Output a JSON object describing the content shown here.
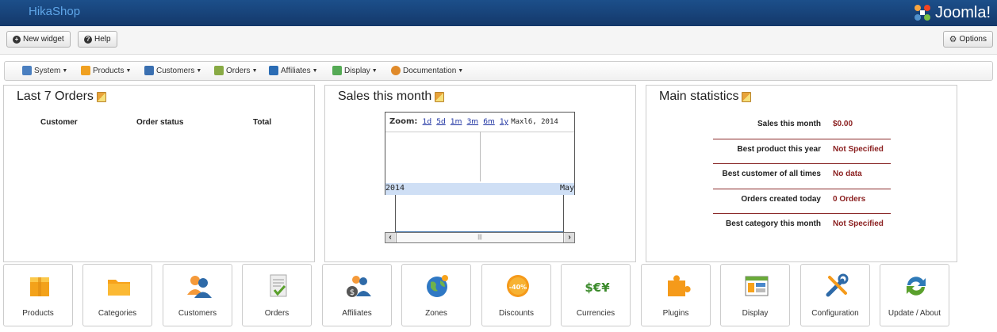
{
  "header": {
    "title": "HikaShop",
    "brand": "Joomla!"
  },
  "toolbar": {
    "new_widget": "New widget",
    "help": "Help",
    "options": "Options"
  },
  "menu": [
    {
      "label": "System",
      "icon": "tools-icon",
      "color": "#4a7fc0"
    },
    {
      "label": "Products",
      "icon": "box-icon",
      "color": "#f0a020"
    },
    {
      "label": "Customers",
      "icon": "users-icon",
      "color": "#3a6fb0"
    },
    {
      "label": "Orders",
      "icon": "orders-icon",
      "color": "#88aa44"
    },
    {
      "label": "Affiliates",
      "icon": "affiliates-icon",
      "color": "#2b6cb4"
    },
    {
      "label": "Display",
      "icon": "display-icon",
      "color": "#55aa55"
    },
    {
      "label": "Documentation",
      "icon": "lifebuoy-icon",
      "color": "#e08a2a"
    }
  ],
  "panels": {
    "orders": {
      "title": "Last 7 Orders",
      "columns": [
        "Customer",
        "Order status",
        "Total"
      ]
    },
    "sales": {
      "title": "Sales this month",
      "zoom_label": "Zoom:",
      "zoom_levels": [
        "1d",
        "5d",
        "1m",
        "3m",
        "6m",
        "1y"
      ],
      "zoom_max": "Max",
      "date_display": "l6, 2014",
      "axis_left": "2014",
      "axis_right": "May"
    },
    "stats": {
      "title": "Main statistics",
      "rows": [
        {
          "label": "Sales this month",
          "value": "$0.00"
        },
        {
          "label": "Best product this year",
          "value": "Not Specified"
        },
        {
          "label": "Best customer of all times",
          "value": "No data"
        },
        {
          "label": "Orders created today",
          "value": "0 Orders"
        },
        {
          "label": "Best category this month",
          "value": "Not Specified"
        }
      ]
    }
  },
  "tiles": [
    {
      "label": "Products",
      "icon": "product-box-icon"
    },
    {
      "label": "Categories",
      "icon": "folder-icon"
    },
    {
      "label": "Customers",
      "icon": "customers-icon"
    },
    {
      "label": "Orders",
      "icon": "order-document-icon"
    },
    {
      "label": "Affiliates",
      "icon": "affiliates-money-icon"
    },
    {
      "label": "Zones",
      "icon": "globe-icon"
    },
    {
      "label": "Discounts",
      "icon": "discount-badge-icon"
    },
    {
      "label": "Currencies",
      "icon": "currency-icon"
    },
    {
      "label": "Plugins",
      "icon": "puzzle-icon"
    },
    {
      "label": "Display",
      "icon": "display-window-icon"
    },
    {
      "label": "Configuration",
      "icon": "tools-config-icon"
    },
    {
      "label": "Update / About",
      "icon": "update-arrows-icon"
    }
  ],
  "currency_glyphs": "$€¥",
  "discount_text": "-40%"
}
